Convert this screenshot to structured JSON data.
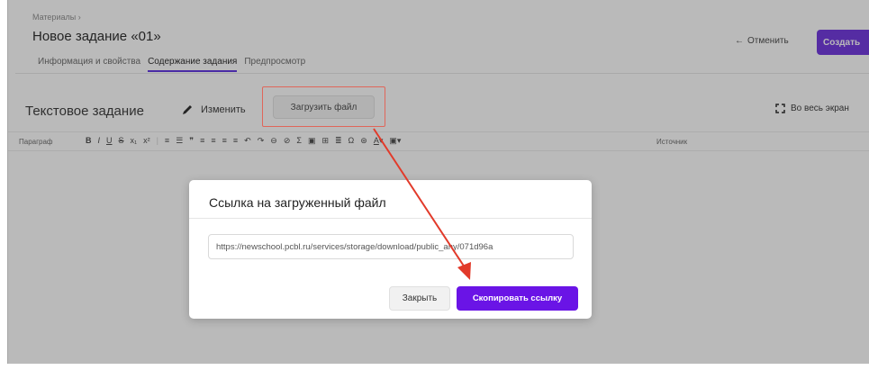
{
  "header": {
    "breadcrumb": "Материалы ›",
    "title": "Новое задание «01»",
    "cancel_label": "Отменить",
    "create_label": "Создать"
  },
  "tabs": [
    {
      "label": "Информация и свойства",
      "active": false
    },
    {
      "label": "Содержание задания",
      "active": true
    },
    {
      "label": "Предпросмотр",
      "active": false
    }
  ],
  "editor": {
    "title": "Текстовое задание",
    "edit_label": "Изменить",
    "upload_label": "Загрузить файл",
    "fullscreen_label": "Во весь экран",
    "paragraph_label": "Параграф",
    "source_label": "Источник"
  },
  "modal": {
    "title": "Ссылка на загруженный файл",
    "link_value": "https://newschool.pcbl.ru/services/storage/download/public_any/071d96a",
    "close_label": "Закрыть",
    "copy_label": "Скопировать ссылку"
  },
  "colors": {
    "accent": "#6a14e6",
    "highlight": "#e0665a"
  }
}
